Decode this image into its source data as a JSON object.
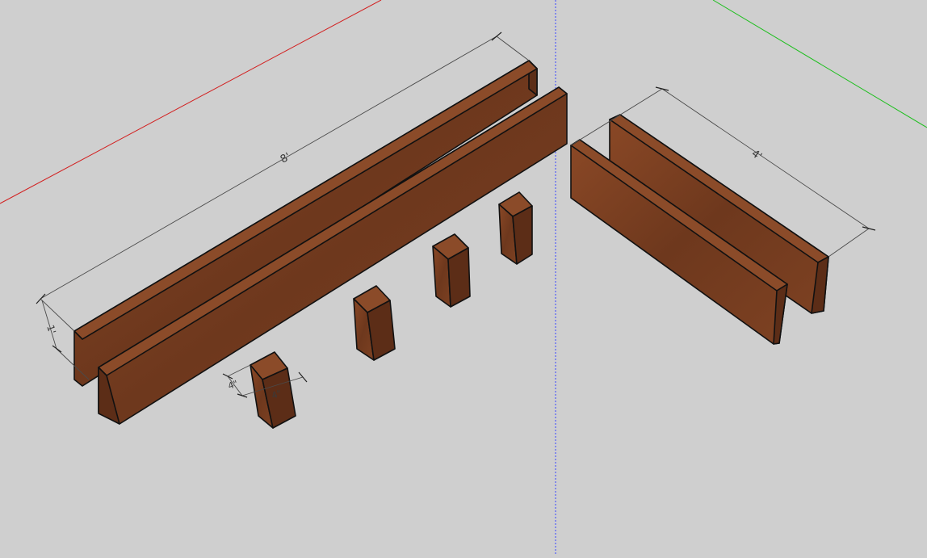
{
  "viewport": {
    "axes": {
      "x_axis_color": "#d22020",
      "y_axis_color": "#1fbf1f",
      "z_axis_color": "#3a46ff"
    },
    "material": {
      "wood_front": "#7a3f22",
      "wood_side": "#5c2d17",
      "wood_top": "#8b4b29"
    },
    "dimensions": {
      "long_board_length": "8'",
      "long_board_height": "1'",
      "short_board_length": "4'",
      "post_width": "4\"",
      "post_depth": "4\""
    }
  }
}
